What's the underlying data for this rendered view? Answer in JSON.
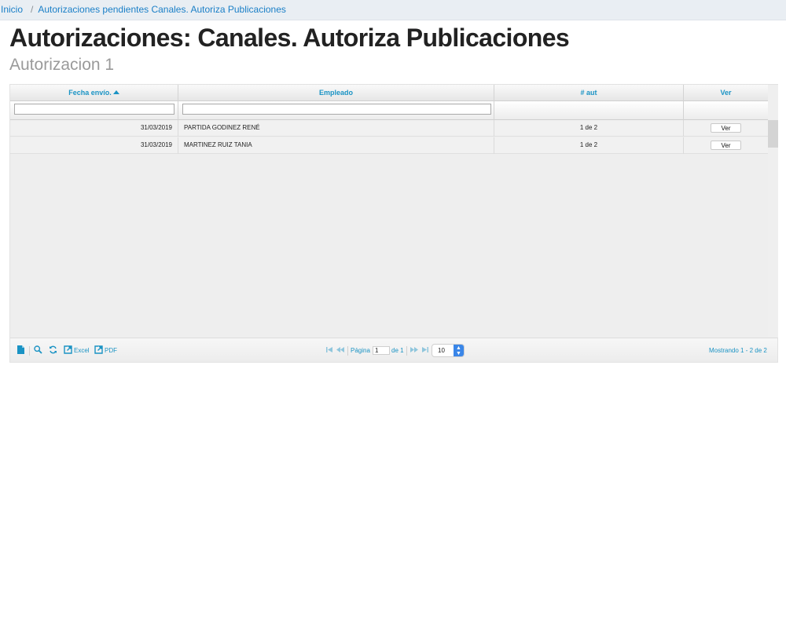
{
  "breadcrumb": {
    "home": "Inicio",
    "separator": "/",
    "current": "Autorizaciones pendientes Canales. Autoriza Publicaciones"
  },
  "page": {
    "title": "Autorizaciones: Canales. Autoriza Publicaciones",
    "subtitle": "Autorizacion 1"
  },
  "grid": {
    "columns": {
      "fecha": "Fecha envío.",
      "empleado": "Empleado",
      "aut": "# aut",
      "ver": "Ver"
    },
    "rows": [
      {
        "fecha": "31/03/2019",
        "empleado": "PARTIDA GODINEZ RENÉ",
        "aut": "1 de 2",
        "ver": "Ver"
      },
      {
        "fecha": "31/03/2019",
        "empleado": "MARTINEZ RUIZ TANIA",
        "aut": "1 de 2",
        "ver": "Ver"
      }
    ]
  },
  "pager": {
    "excel_label": "Excel",
    "pdf_label": "PDF",
    "page_label": "Página",
    "page_value": "1",
    "of_label": "de 1",
    "rows_per_page": "10",
    "records_text": "Mostrando 1 - 2 de 2"
  },
  "colors": {
    "link": "#1a7fc7",
    "accent": "#1a93c4",
    "select_caret": "#3a86e8"
  }
}
